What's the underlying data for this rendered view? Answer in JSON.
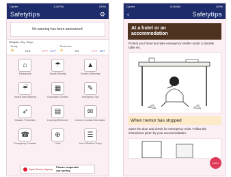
{
  "left": {
    "status": {
      "carrier": "Carrier",
      "time": "1:25 PM",
      "battery": "100%"
    },
    "nav": {
      "brand_prefix": "Safety",
      "brand_suffix": "tips",
      "gear_icon": "gear-icon"
    },
    "announcement": "No warning has been announced.",
    "weather": {
      "location": "Shinjuku City, Tokyo",
      "days": [
        {
          "label": "Today",
          "icon": "sun-cloud-icon",
          "pop": "10%",
          "high": "17°F",
          "low": "54°F"
        },
        {
          "label": "Tomorrow",
          "icon": "sun-cloud-icon",
          "pop": "0%",
          "high": "71°F",
          "low": "45°F"
        }
      ]
    },
    "tiles": [
      {
        "label": "Earthquake",
        "icon": "earthquake-icon"
      },
      {
        "label": "Sports Warning",
        "icon": "rain-icon"
      },
      {
        "label": "Volcanic Warnings",
        "icon": "volcano-icon"
      },
      {
        "label": "Heavy Rain Warning",
        "icon": "heavy-rain-icon"
      },
      {
        "label": "Evacuation Centers",
        "icon": "building-icon"
      },
      {
        "label": "Emergency Tips",
        "icon": "tips-icon"
      },
      {
        "label": "Disaster Prevention",
        "icon": "running-person-icon"
      },
      {
        "label": "Learning Reference",
        "icon": "book-icon"
      },
      {
        "label": "Links to Contact Information",
        "icon": "chat-icon"
      },
      {
        "label": "Emergency Contacts",
        "icon": "phone-icon"
      },
      {
        "label": "Links",
        "icon": "globe-icon"
      },
      {
        "label": "List of Shelters Tokyo",
        "icon": "list-icon"
      }
    ],
    "banner": {
      "org": "Japan Tourism Agency",
      "cta_line1": "Please cooperate",
      "cta_line2": "our survey."
    }
  },
  "right": {
    "status": {
      "carrier": "Carrier",
      "time": "8:28 AM",
      "battery": "100%"
    },
    "nav": {
      "brand_prefix": "Safety",
      "brand_suffix": "tips",
      "back_icon": "back-arrow-icon"
    },
    "section1": {
      "title_line1": "At a hotel or an",
      "title_line2": "accommodation",
      "text": "Protect your head and take emergency shelter under a durable table etc."
    },
    "section2": {
      "title": "When tremor has stopped",
      "text": "Open the door and check for emergency exits. Follow the instructions given by your accommodation."
    },
    "fab": {
      "label": "Home",
      "icon": "home-icon"
    }
  },
  "colors": {
    "navy": "#1d2d6b",
    "pink_bg": "#fbeff3",
    "heading_brown": "#4e3220",
    "heading_light": "#fdeac9",
    "fab": "#e03a5a"
  }
}
